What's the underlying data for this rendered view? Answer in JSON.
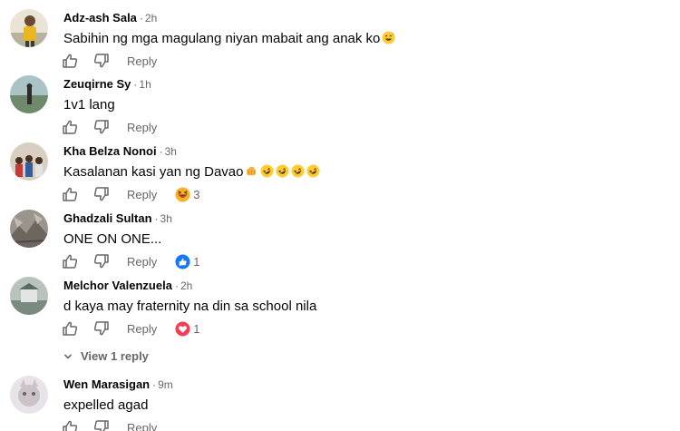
{
  "comments": [
    {
      "author": "Adz-ash Sala",
      "time": "2h",
      "text": "Sabihin ng mga magulang niyan mabait ang anak ko",
      "emoji": [
        "grin-sweat"
      ],
      "reply_label": "Reply",
      "reaction": null
    },
    {
      "author": "Zeuqirne Sy",
      "time": "1h",
      "text": "1v1 lang",
      "emoji": [],
      "reply_label": "Reply",
      "reaction": null
    },
    {
      "author": "Kha Belza Nonoi",
      "time": "3h",
      "text": "Kasalanan kasi yan ng Davao",
      "emoji": [
        "fist",
        "rofl",
        "rofl",
        "rofl",
        "rofl"
      ],
      "reply_label": "Reply",
      "reaction": {
        "icon": "haha-icon",
        "count": "3"
      }
    },
    {
      "author": "Ghadzali Sultan",
      "time": "3h",
      "text": "ONE ON ONE...",
      "emoji": [],
      "reply_label": "Reply",
      "reaction": {
        "icon": "like-icon",
        "count": "1"
      }
    },
    {
      "author": "Melchor Valenzuela",
      "time": "2h",
      "text": "d kaya may fraternity na din sa school nila",
      "emoji": [],
      "reply_label": "Reply",
      "reaction": {
        "icon": "love-icon",
        "count": "1"
      }
    },
    {
      "author": "Wen Marasigan",
      "time": "9m",
      "text": "expelled agad",
      "emoji": [],
      "reply_label": "Reply",
      "reaction": null
    }
  ],
  "view_replies_label": "View 1 reply",
  "colors": {
    "secondary_text": "#65676b",
    "like_blue": "#1877f2",
    "love_red": "#f33e58",
    "haha_yellow": "#f7b125"
  }
}
